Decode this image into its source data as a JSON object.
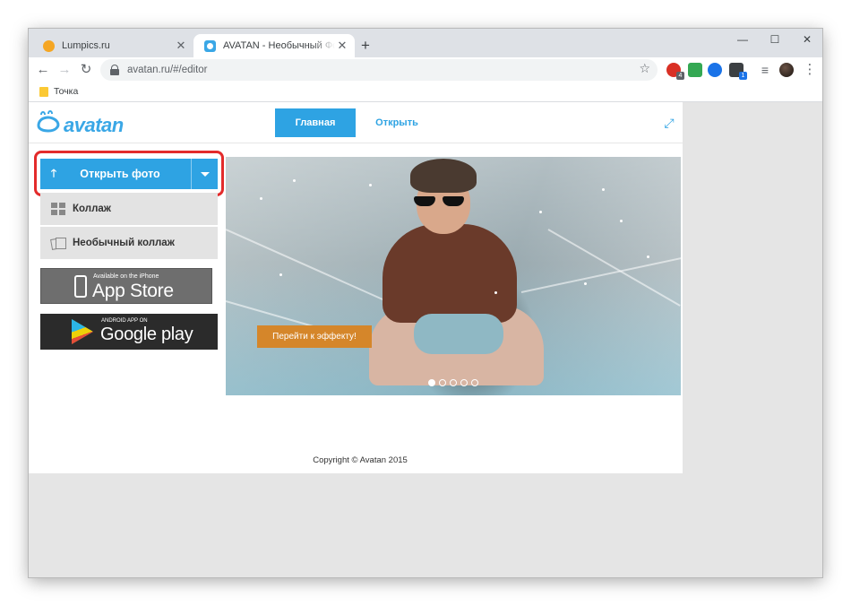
{
  "browser": {
    "tabs": [
      {
        "title": "Lumpics.ru",
        "active": false
      },
      {
        "title": "AVATAN - Необычный Фоторедактор",
        "active": true
      }
    ],
    "new_tab": "+",
    "close_glyph": "✕",
    "window_controls": {
      "minimize": "—",
      "maximize": "☐",
      "close": "✕"
    },
    "nav": {
      "back": "←",
      "forward": "→",
      "reload": "↻"
    },
    "url": "avatan.ru/#/editor",
    "bookmark_star": "☆",
    "extensions": [
      {
        "name": "adblock-icon",
        "color": "#d93025",
        "badge": "4"
      },
      {
        "name": "music-icon",
        "color": "#34a853",
        "badge": ""
      },
      {
        "name": "vpn-icon",
        "color": "#1a73e8",
        "badge": ""
      },
      {
        "name": "cube-icon",
        "color": "#3c4043",
        "badge": "1"
      }
    ],
    "menu_glyph": "⋮",
    "playlist_glyph": "≡",
    "bookmarks": [
      {
        "label": "Точка"
      }
    ]
  },
  "site": {
    "logo": "avatan",
    "nav": {
      "main": "Главная",
      "open": "Открыть"
    },
    "expand_glyph": "⤢",
    "sidebar": {
      "open_photo": "Открыть фото",
      "upload_glyph": "🡑",
      "collage": "Коллаж",
      "unusual_collage": "Необычный коллаж",
      "appstore": {
        "small": "Available on the iPhone",
        "big": "App Store"
      },
      "googleplay": {
        "small": "ANDROID APP ON",
        "big": "Google play"
      }
    },
    "banner": {
      "cta": "Перейти к эффекту!",
      "slides": 5,
      "active_slide": 1
    },
    "copyright": "Copyright © Avatan 2015"
  },
  "colors": {
    "accent": "#2ea3e3",
    "highlight": "#e32b2b",
    "cta": "#d5862a"
  }
}
